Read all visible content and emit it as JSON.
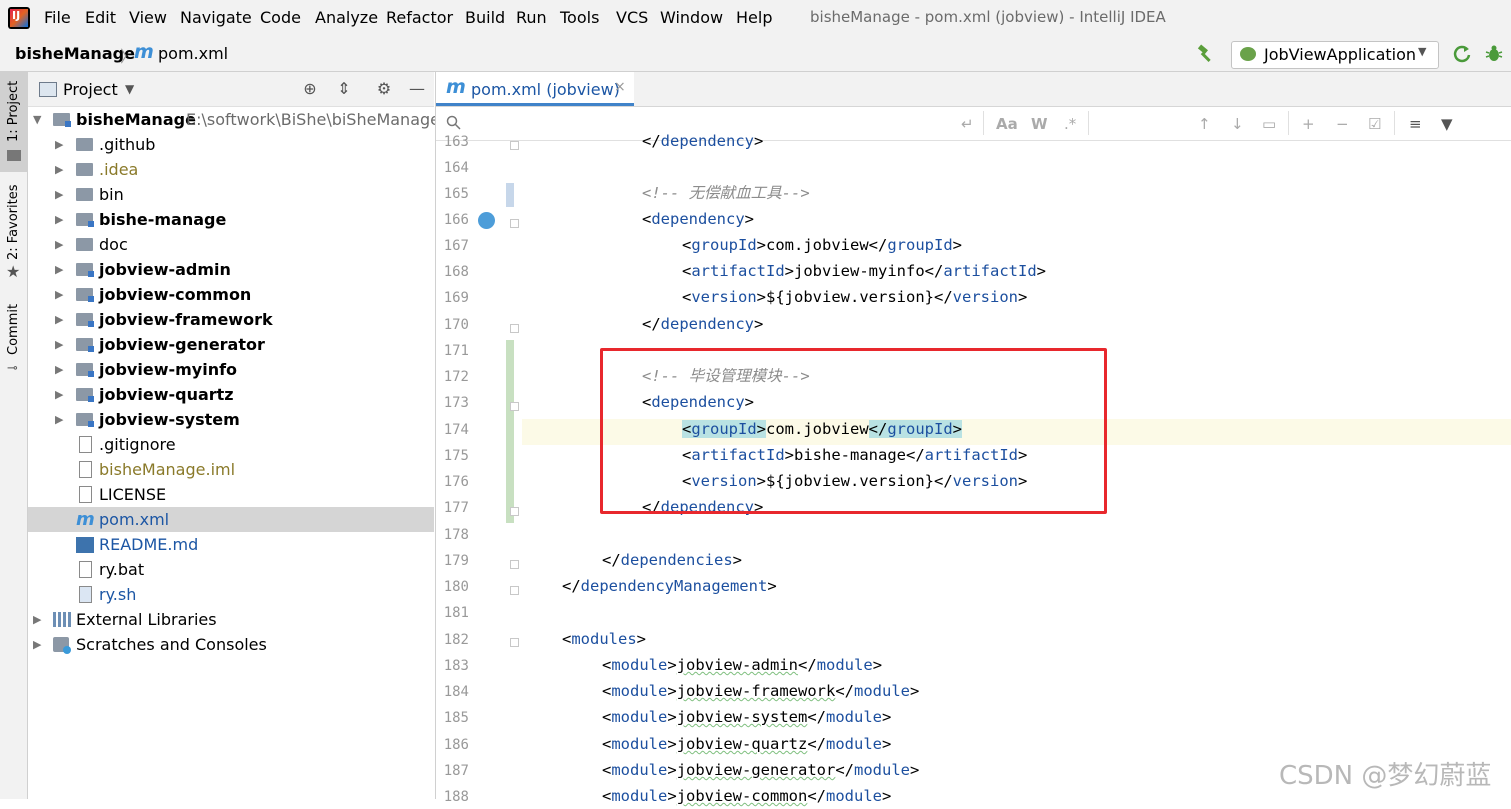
{
  "menu": {
    "items": [
      "File",
      "Edit",
      "View",
      "Navigate",
      "Code",
      "Analyze",
      "Refactor",
      "Build",
      "Run",
      "Tools",
      "VCS",
      "Window",
      "Help"
    ],
    "window_title": "bisheManage - pom.xml (jobview) - IntelliJ IDEA"
  },
  "navbar": {
    "project": "bisheManage",
    "file_icon": "m",
    "file": "pom.xml",
    "run_config": "JobViewApplication"
  },
  "left_strip": {
    "tabs": [
      "1: Project",
      "2: Favorites",
      "Commit"
    ]
  },
  "project_panel": {
    "title": "Project",
    "tree": [
      {
        "label": "bisheManage",
        "path": "E:\\softwork\\BiShe\\biSheManage\\b",
        "type": "root"
      },
      {
        "label": ".github",
        "type": "folder"
      },
      {
        "label": ".idea",
        "type": "folder"
      },
      {
        "label": "bin",
        "type": "folder"
      },
      {
        "label": "bishe-manage",
        "type": "module"
      },
      {
        "label": "doc",
        "type": "folder"
      },
      {
        "label": "jobview-admin",
        "type": "module"
      },
      {
        "label": "jobview-common",
        "type": "module"
      },
      {
        "label": "jobview-framework",
        "type": "module"
      },
      {
        "label": "jobview-generator",
        "type": "module"
      },
      {
        "label": "jobview-myinfo",
        "type": "module"
      },
      {
        "label": "jobview-quartz",
        "type": "module"
      },
      {
        "label": "jobview-system",
        "type": "module"
      },
      {
        "label": ".gitignore",
        "type": "file"
      },
      {
        "label": "bisheManage.iml",
        "type": "file"
      },
      {
        "label": "LICENSE",
        "type": "file"
      },
      {
        "label": "pom.xml",
        "type": "pom"
      },
      {
        "label": "README.md",
        "type": "md"
      },
      {
        "label": "ry.bat",
        "type": "file"
      },
      {
        "label": "ry.sh",
        "type": "file"
      },
      {
        "label": "External Libraries",
        "type": "lib"
      },
      {
        "label": "Scratches and Consoles",
        "type": "scratch"
      }
    ]
  },
  "editor": {
    "tab_icon": "m",
    "tab_label": "pom.xml (jobview)",
    "tab_close": "×",
    "line_numbers": [
      "163",
      "164",
      "165",
      "166",
      "167",
      "168",
      "169",
      "170",
      "171",
      "172",
      "173",
      "174",
      "175",
      "176",
      "177",
      "178",
      "179",
      "180",
      "181",
      "182",
      "183",
      "184",
      "185",
      "186",
      "187",
      "188"
    ],
    "comments": {
      "c165": "<!-- 无偿献血工具-->",
      "c172": "<!-- 毕设管理模块-->"
    },
    "values": {
      "group1": "com.jobview",
      "artifact1": "jobview-myinfo",
      "version1": "${jobview.version}",
      "group2": "com.jobview",
      "artifact2": "bishe-manage",
      "version2": "${jobview.version}"
    },
    "tags": {
      "dependency": "dependency",
      "dependencies": "dependencies",
      "dependencyManagement": "dependencyManagement",
      "groupId": "groupId",
      "artifactId": "artifactId",
      "version": "version",
      "modules": "modules",
      "module": "module"
    },
    "modules": [
      "jobview-admin",
      "jobview-framework",
      "jobview-system",
      "jobview-quartz",
      "jobview-generator",
      "jobview-common"
    ],
    "current_line": "174"
  },
  "watermark": "CSDN @梦幻蔚蓝",
  "colors": {
    "tag": "#1c4f9f",
    "comment": "#8c8c8c",
    "highlight_box": "#e8282d",
    "selection": "#d5d5d5"
  }
}
